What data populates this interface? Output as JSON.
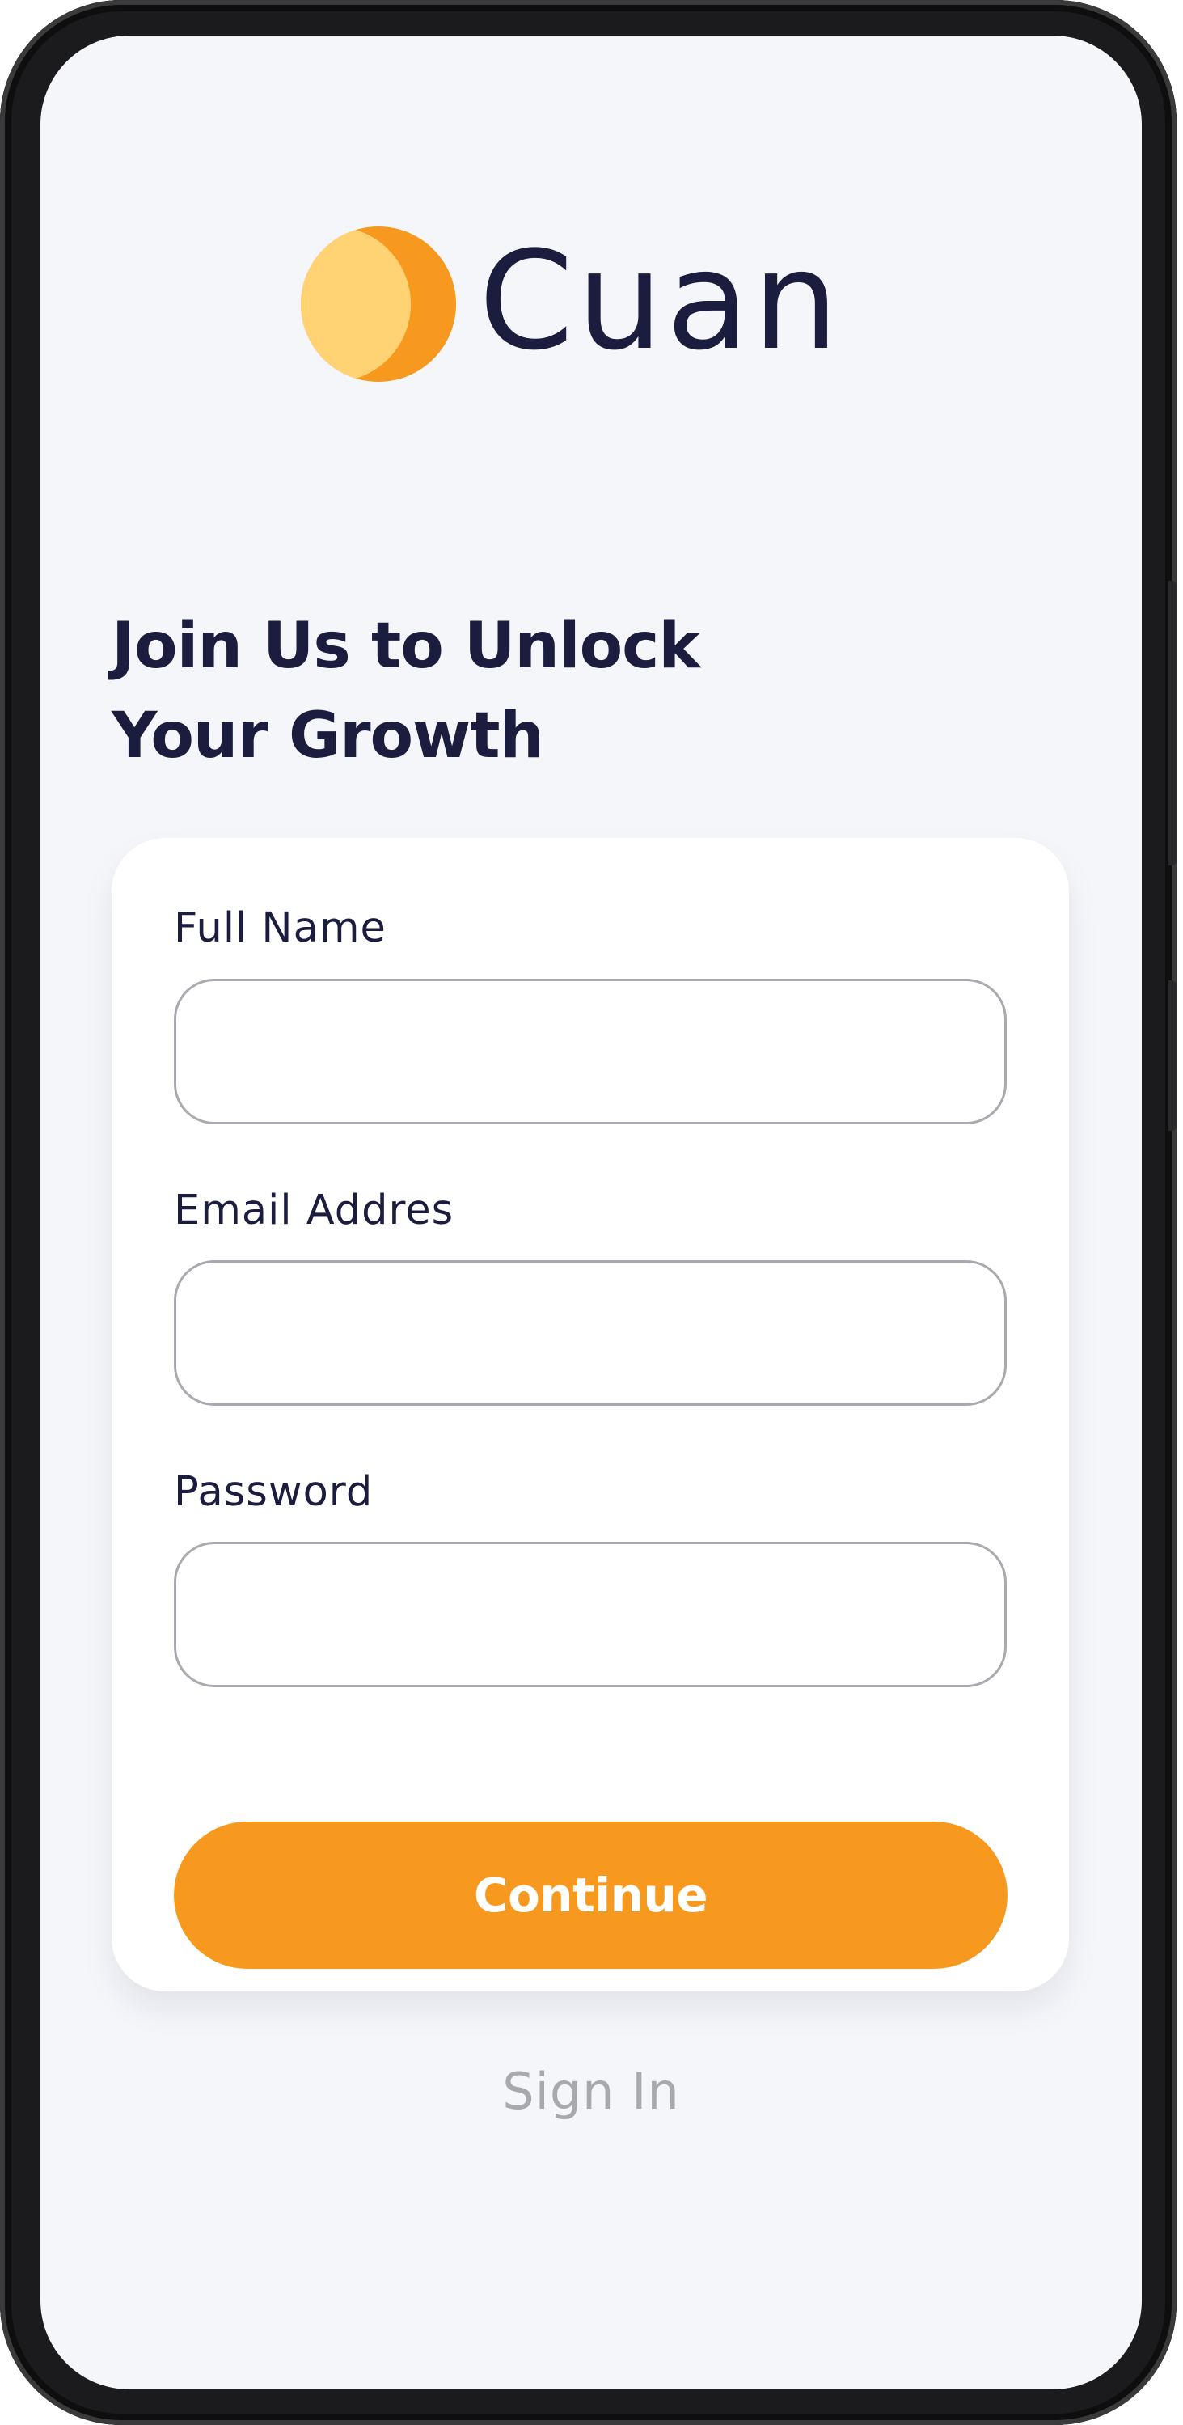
{
  "brand": {
    "name": "Cuan",
    "colors": {
      "accent": "#f7991e",
      "accent_light": "#ffd374",
      "text_dark": "#1b1d3f",
      "muted": "#a7a9ae",
      "background": "#f5f6fa",
      "card": "#ffffff"
    },
    "logo_icon": "crescent-moon-icon"
  },
  "heading": {
    "line1": "Join Us to Unlock",
    "line2": "Your Growth"
  },
  "form": {
    "full_name": {
      "label": "Full Name",
      "value": "",
      "placeholder": ""
    },
    "email": {
      "label": "Email Addres",
      "value": "",
      "placeholder": ""
    },
    "password": {
      "label": "Password",
      "value": "",
      "placeholder": ""
    },
    "continue_label": "Continue"
  },
  "footer": {
    "sign_in_label": "Sign In"
  }
}
